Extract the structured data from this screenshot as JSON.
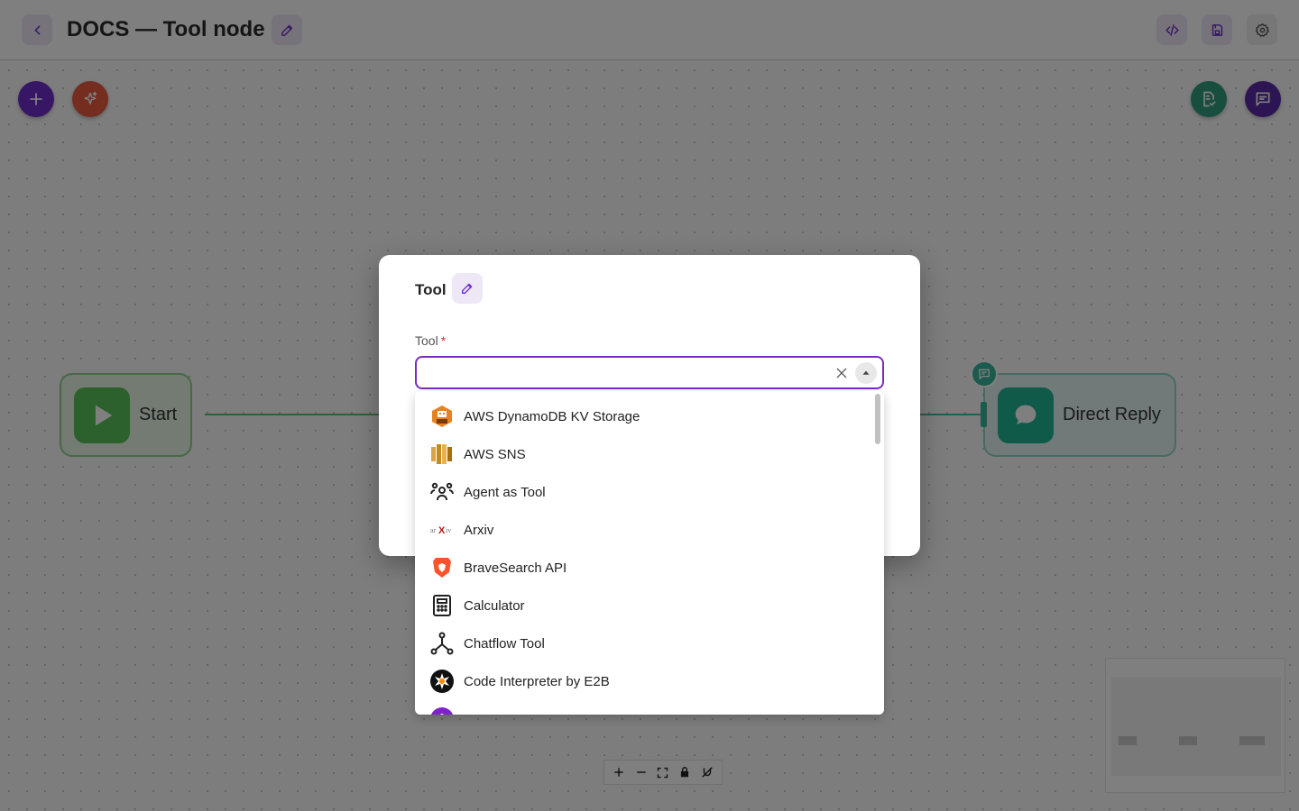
{
  "header": {
    "title": "DOCS — Tool node"
  },
  "canvas": {
    "nodes": {
      "start_label": "Start",
      "reply_label": "Direct Reply"
    }
  },
  "dialog": {
    "title": "Tool",
    "field_label": "Tool",
    "required_mark": "*",
    "input_value": "",
    "options": [
      {
        "label": "AWS DynamoDB KV Storage",
        "icon": "aws-dynamodb-icon"
      },
      {
        "label": "AWS SNS",
        "icon": "aws-sns-icon"
      },
      {
        "label": "Agent as Tool",
        "icon": "agent-icon"
      },
      {
        "label": "Arxiv",
        "icon": "arxiv-icon"
      },
      {
        "label": "BraveSearch API",
        "icon": "brave-icon"
      },
      {
        "label": "Calculator",
        "icon": "calculator-icon"
      },
      {
        "label": "Chatflow Tool",
        "icon": "chatflow-icon"
      },
      {
        "label": "Code Interpreter by E2B",
        "icon": "e2b-icon"
      },
      {
        "label": "",
        "icon": "partial-item-icon"
      }
    ]
  },
  "colors": {
    "accent": "#7b2cbf",
    "start_green": "#58c25a",
    "reply_teal": "#21b495",
    "generate_orange": "#e85a3f"
  }
}
